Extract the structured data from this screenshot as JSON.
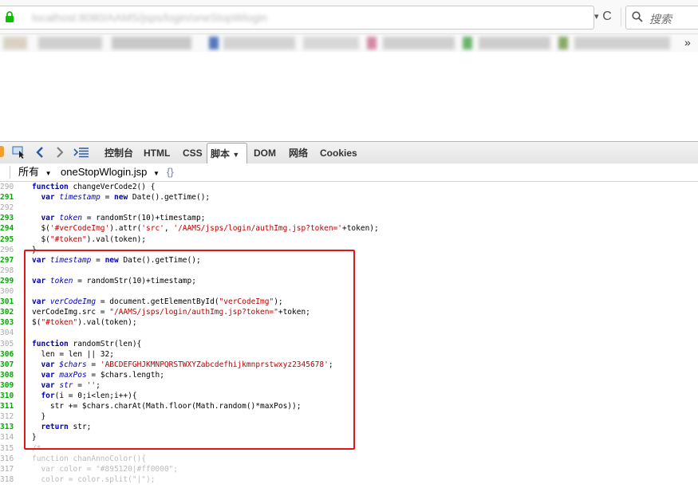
{
  "browser": {
    "url_blurred": "localhost:8080/AAMS/jsps/login/oneStopWlogin",
    "search_placeholder": "搜索",
    "bookmarks_more": "»",
    "reload": "C"
  },
  "firebug": {
    "tabs": [
      {
        "label": "控制台",
        "active": false
      },
      {
        "label": "HTML",
        "active": false
      },
      {
        "label": "CSS",
        "active": false
      },
      {
        "label": "脚本",
        "active": true
      },
      {
        "label": "DOM",
        "active": false
      },
      {
        "label": "网络",
        "active": false
      },
      {
        "label": "Cookies",
        "active": false
      }
    ],
    "script_filter": "所有",
    "script_file": "oneStopWlogin.jsp",
    "pretty_print": "{}"
  },
  "code_lines": [
    {
      "n": "290",
      "exec": false,
      "text": "function changeVerCode2() {"
    },
    {
      "n": "291",
      "exec": true,
      "text": "  var timestamp = new Date().getTime();"
    },
    {
      "n": "292",
      "exec": false,
      "text": ""
    },
    {
      "n": "293",
      "exec": true,
      "text": "  var token = randomStr(10)+timestamp;"
    },
    {
      "n": "294",
      "exec": true,
      "text": "  $('#verCodeImg').attr('src', '/AAMS/jsps/login/authImg.jsp?token='+token);"
    },
    {
      "n": "295",
      "exec": true,
      "text": "  $(\"#token\").val(token);"
    },
    {
      "n": "296",
      "exec": false,
      "text": "}"
    },
    {
      "n": "297",
      "exec": true,
      "text": "var timestamp = new Date().getTime();"
    },
    {
      "n": "298",
      "exec": false,
      "text": ""
    },
    {
      "n": "299",
      "exec": true,
      "text": "var token = randomStr(10)+timestamp;"
    },
    {
      "n": "300",
      "exec": false,
      "text": ""
    },
    {
      "n": "301",
      "exec": true,
      "text": "var verCodeImg = document.getElementById(\"verCodeImg\");"
    },
    {
      "n": "302",
      "exec": true,
      "text": "verCodeImg.src = \"/AAMS/jsps/login/authImg.jsp?token=\"+token;"
    },
    {
      "n": "303",
      "exec": true,
      "text": "$(\"#token\").val(token);"
    },
    {
      "n": "304",
      "exec": false,
      "text": ""
    },
    {
      "n": "305",
      "exec": false,
      "text": "function randomStr(len){"
    },
    {
      "n": "306",
      "exec": true,
      "text": "  len = len || 32;"
    },
    {
      "n": "307",
      "exec": true,
      "text": "  var $chars = 'ABCDEFGHJKMNPQRSTWXYZabcdefhijkmnprstwxyz2345678';"
    },
    {
      "n": "308",
      "exec": true,
      "text": "  var maxPos = $chars.length;"
    },
    {
      "n": "309",
      "exec": true,
      "text": "  var str = '';"
    },
    {
      "n": "310",
      "exec": true,
      "text": "  for(i = 0;i<len;i++){"
    },
    {
      "n": "311",
      "exec": true,
      "text": "    str += $chars.charAt(Math.floor(Math.random()*maxPos));"
    },
    {
      "n": "312",
      "exec": false,
      "text": "  }"
    },
    {
      "n": "313",
      "exec": true,
      "text": "  return str;"
    },
    {
      "n": "314",
      "exec": false,
      "text": "}"
    },
    {
      "n": "315",
      "exec": false,
      "text": "/*"
    },
    {
      "n": "316",
      "exec": false,
      "text": "function chanAnnoColor(){"
    },
    {
      "n": "317",
      "exec": false,
      "text": "  var color = \"#895120|#ff0000\";"
    },
    {
      "n": "318",
      "exec": false,
      "text": "  color = color.split(\"|\");"
    }
  ],
  "colors": {
    "highlight_border": "#e4141b",
    "exec_line_number": "#00aa00",
    "keyword": "#0000bb",
    "string": "#bb0000"
  }
}
